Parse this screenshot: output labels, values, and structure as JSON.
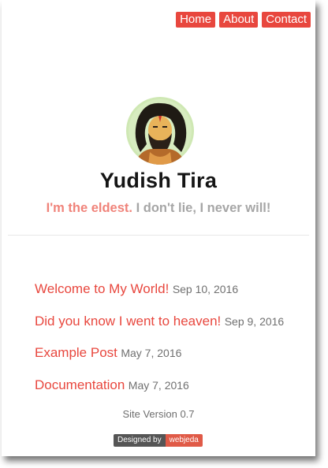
{
  "nav": {
    "home": "Home",
    "about": "About",
    "contact": "Contact"
  },
  "profile": {
    "name": "Yudish Tira",
    "tagline_accent": "I'm the eldest.",
    "tagline_rest": "I don't lie, I never will!"
  },
  "posts": [
    {
      "title": "Welcome to My World!",
      "date": "Sep 10, 2016"
    },
    {
      "title": "Did you know I went to heaven!",
      "date": "Sep 9, 2016"
    },
    {
      "title": "Example Post",
      "date": "May 7, 2016"
    },
    {
      "title": "Documentation",
      "date": "May 7, 2016"
    }
  ],
  "footer": {
    "site_version": "Site Version 0.7",
    "designed_by": "Designed by",
    "designer": "webjeda"
  },
  "colors": {
    "accent": "#e8473e",
    "tagline_accent": "#f0837a",
    "muted": "#a6a6a6"
  }
}
